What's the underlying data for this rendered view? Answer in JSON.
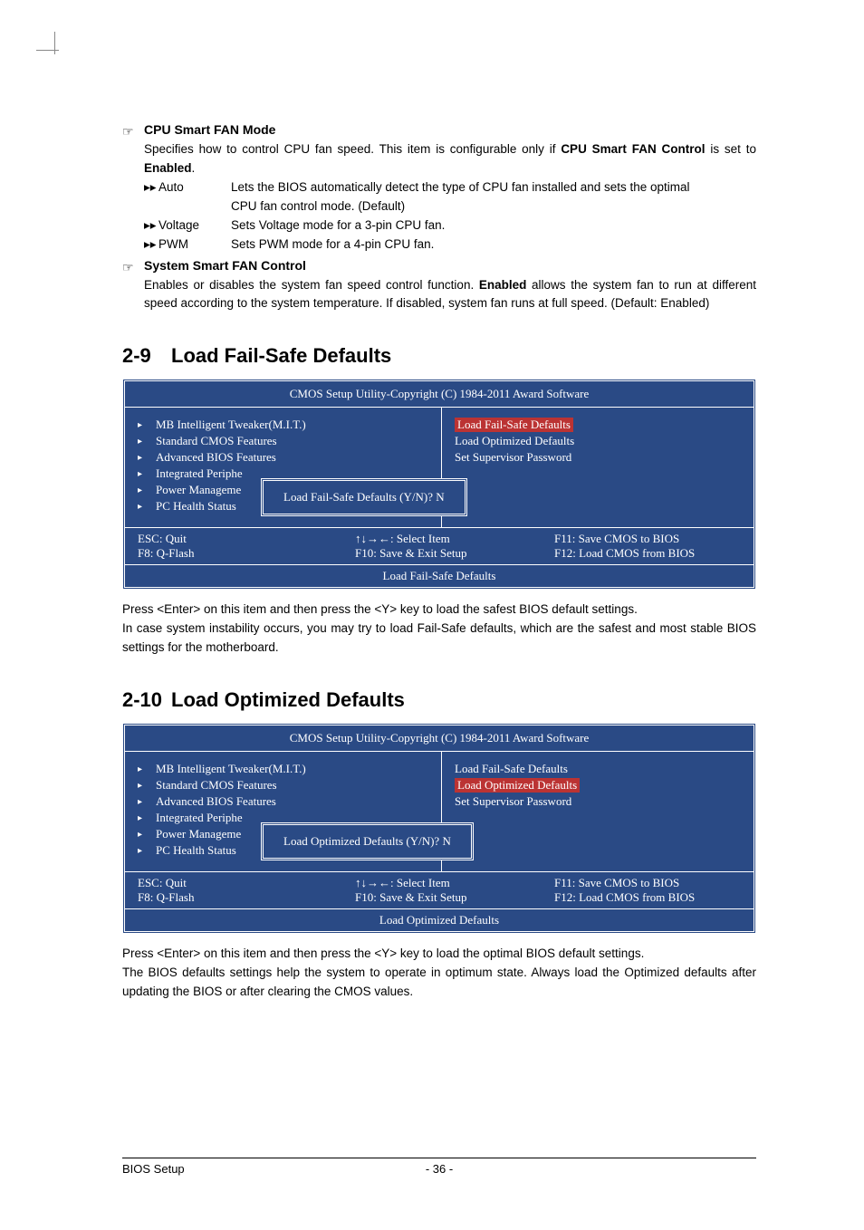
{
  "sec1": {
    "title": "CPU Smart FAN Mode",
    "desc_pre": "Specifies how to control CPU fan speed. This item is configurable only if ",
    "desc_bold": "CPU Smart FAN Control",
    "desc_mid": " is set to ",
    "desc_bold2": "Enabled",
    "desc_post": ".",
    "opts": [
      {
        "label": "Auto",
        "desc1": "Lets the BIOS automatically detect the type of CPU fan installed and sets the optimal",
        "desc2": "CPU fan control mode. (Default)"
      },
      {
        "label": "Voltage",
        "desc1": "Sets Voltage mode for a 3-pin CPU fan."
      },
      {
        "label": "PWM",
        "desc1": "Sets PWM mode for a 4-pin CPU fan."
      }
    ]
  },
  "sec2": {
    "title": "System Smart FAN Control",
    "desc": "Enables or disables the system fan speed control function. Enabled allows the system fan to run at different speed according to the system temperature. If disabled, system fan runs at full speed. (Default: Enabled)",
    "desc_pre": "Enables or disables the system fan speed control function. ",
    "desc_bold": "Enabled",
    "desc_post": " allows the system fan to run at different speed according to the system temperature. If disabled, system fan runs at full speed. (Default: Enabled)"
  },
  "h29": {
    "num": "2-9",
    "title": "Load Fail-Safe Defaults"
  },
  "h210": {
    "num": "2-10",
    "title": "Load Optimized Defaults"
  },
  "bios": {
    "title": "CMOS Setup Utility-Copyright (C) 1984-2011 Award Software",
    "left": [
      "MB Intelligent Tweaker(M.I.T.)",
      "Standard CMOS Features",
      "Advanced BIOS Features",
      "Integrated Periphe",
      "Power Manageme",
      "PC Health Status"
    ],
    "right": [
      "Load Fail-Safe Defaults",
      "Load Optimized Defaults",
      "Set Supervisor Password"
    ],
    "footer": {
      "r1c1": "ESC: Quit",
      "r1c2": "↑↓→←: Select Item",
      "r1c3": "F11: Save CMOS to BIOS",
      "r2c1": "F8: Q-Flash",
      "r2c2": "F10: Save & Exit Setup",
      "r2c3": "F12: Load CMOS from BIOS"
    }
  },
  "bios29": {
    "dialog": "Load Fail-Safe Defaults (Y/N)? N",
    "help": "Load Fail-Safe Defaults",
    "highlight_idx": 0
  },
  "bios210": {
    "dialog": "Load Optimized Defaults (Y/N)? N",
    "help": "Load Optimized Defaults",
    "highlight_idx": 1
  },
  "post29": {
    "l1": "Press <Enter> on this item and then press the <Y> key to load the safest BIOS default settings.",
    "l2": "In case system instability occurs, you may try to load Fail-Safe defaults, which are the safest and most stable BIOS settings for the motherboard."
  },
  "post210": {
    "l1": "Press <Enter> on this item and then press the <Y> key to load the optimal BIOS default settings.",
    "l2": "The BIOS defaults settings help the system to operate in optimum state. Always load the Optimized defaults after updating the BIOS or after clearing the CMOS values."
  },
  "footer": {
    "left": "BIOS Setup",
    "center": "- 36 -"
  },
  "glyph": {
    "hand": "☞",
    "arrow": "▸▸",
    "tri": "▸"
  }
}
